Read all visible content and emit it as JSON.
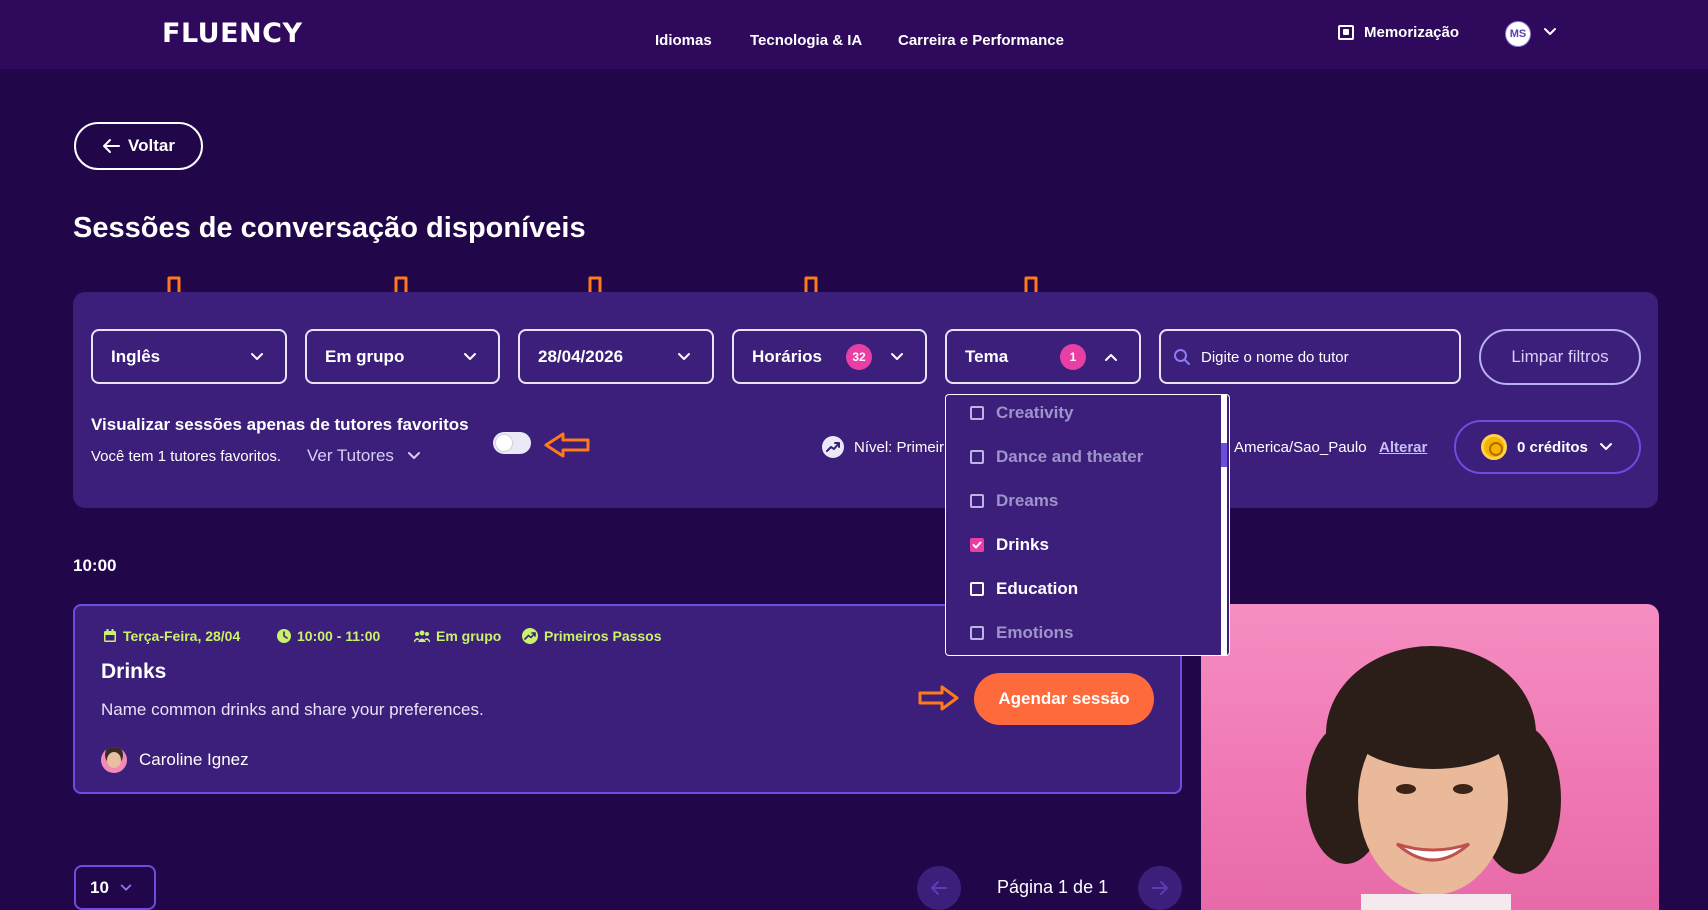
{
  "header": {
    "logo": "FLUENCY",
    "nav": [
      "Idiomas",
      "Tecnologia & IA",
      "Carreira e Performance"
    ],
    "memorizacao": "Memorização",
    "user_initials": "MS"
  },
  "back_button": "Voltar",
  "page_title": "Sessões de conversação disponíveis",
  "filters": {
    "language": "Inglês",
    "format": "Em grupo",
    "date": "28/04/2026",
    "times": {
      "label": "Horários",
      "count": "32"
    },
    "theme": {
      "label": "Tema",
      "count": "1"
    },
    "tutor_search_placeholder": "Digite o nome do tutor",
    "clear_label": "Limpar filtros"
  },
  "theme_options": [
    {
      "label": "Creativity",
      "checked": false,
      "dimmed": true
    },
    {
      "label": "Dance and theater",
      "checked": false,
      "dimmed": true
    },
    {
      "label": "Dreams",
      "checked": false,
      "dimmed": true
    },
    {
      "label": "Drinks",
      "checked": true,
      "dimmed": false
    },
    {
      "label": "Education",
      "checked": false,
      "dimmed": false
    },
    {
      "label": "Emotions",
      "checked": false,
      "dimmed": true
    }
  ],
  "favorites": {
    "title": "Visualizar sessões apenas de tutores favoritos",
    "subtitle": "Você tem 1 tutores favoritos.",
    "link": "Ver Tutores",
    "toggle_on": false
  },
  "level_text": "Nível: Primeir",
  "timezone": "America/Sao_Paulo",
  "timezone_change": "Alterar",
  "credits": "0 créditos",
  "time_slot": "10:00",
  "session": {
    "date": "Terça-Feira, 28/04",
    "time": "10:00 - 11:00",
    "format": "Em grupo",
    "level": "Primeiros Passos",
    "title": "Drinks",
    "description": "Name common drinks and share your preferences.",
    "tutor": "Caroline Ignez",
    "schedule_label": "Agendar sessão"
  },
  "pagination": {
    "per_page": "10",
    "info": "Página 1 de 1"
  },
  "colors": {
    "background": "#22064a",
    "panel": "#3b1f7a",
    "accent_pink": "#e93fa5",
    "accent_orange": "#ff6a3d",
    "meta_green": "#c8f26a",
    "annotation_orange": "#ff7a1a"
  }
}
